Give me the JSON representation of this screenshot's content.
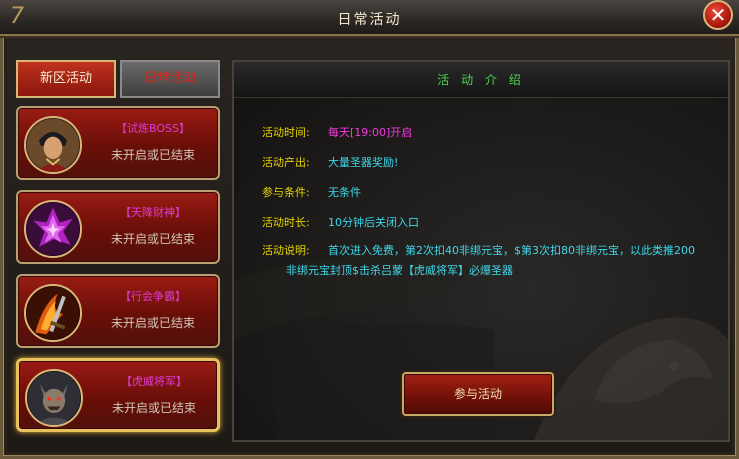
{
  "window": {
    "title": "日常活动",
    "close_symbol": "✕"
  },
  "tabs": [
    {
      "label": "新区活动",
      "active": true
    },
    {
      "label": "日常活动",
      "active": false
    }
  ],
  "events": [
    {
      "name": "【试炼BOSS】",
      "status": "未开启或已结束",
      "icon": "general-portrait-icon"
    },
    {
      "name": "【天降财神】",
      "status": "未开启或已结束",
      "icon": "purple-crystal-icon"
    },
    {
      "name": "【行会争霸】",
      "status": "未开启或已结束",
      "icon": "flame-sword-icon"
    },
    {
      "name": "【虎威将军】",
      "status": "未开启或已结束",
      "icon": "demon-warrior-icon",
      "selected": true
    }
  ],
  "detail": {
    "header": "活 动 介 绍",
    "time_label": "活动时间:",
    "time_value": "每天[19:00]开启",
    "output_label": "活动产出:",
    "output_value": "大量圣器奖励!",
    "condition_label": "参与条件:",
    "condition_value": "无条件",
    "duration_label": "活动时长:",
    "duration_value": "10分钟后关闭入口",
    "desc_label": "活动说明:",
    "desc_line1": "首次进入免费，第2次扣40非绑元宝，$第3次扣80非绑元宝，以此类推200",
    "desc_line2": "非绑元宝封顶$击杀吕蒙【虎威将军】必爆圣器",
    "join_label": "参与活动"
  },
  "colors": {
    "label_yellow": "#e8d400",
    "value_cyan": "#3ed8ea",
    "value_pink": "#f23ae0",
    "header_green": "#4ed44e",
    "event_name_magenta": "#e03ad6"
  }
}
